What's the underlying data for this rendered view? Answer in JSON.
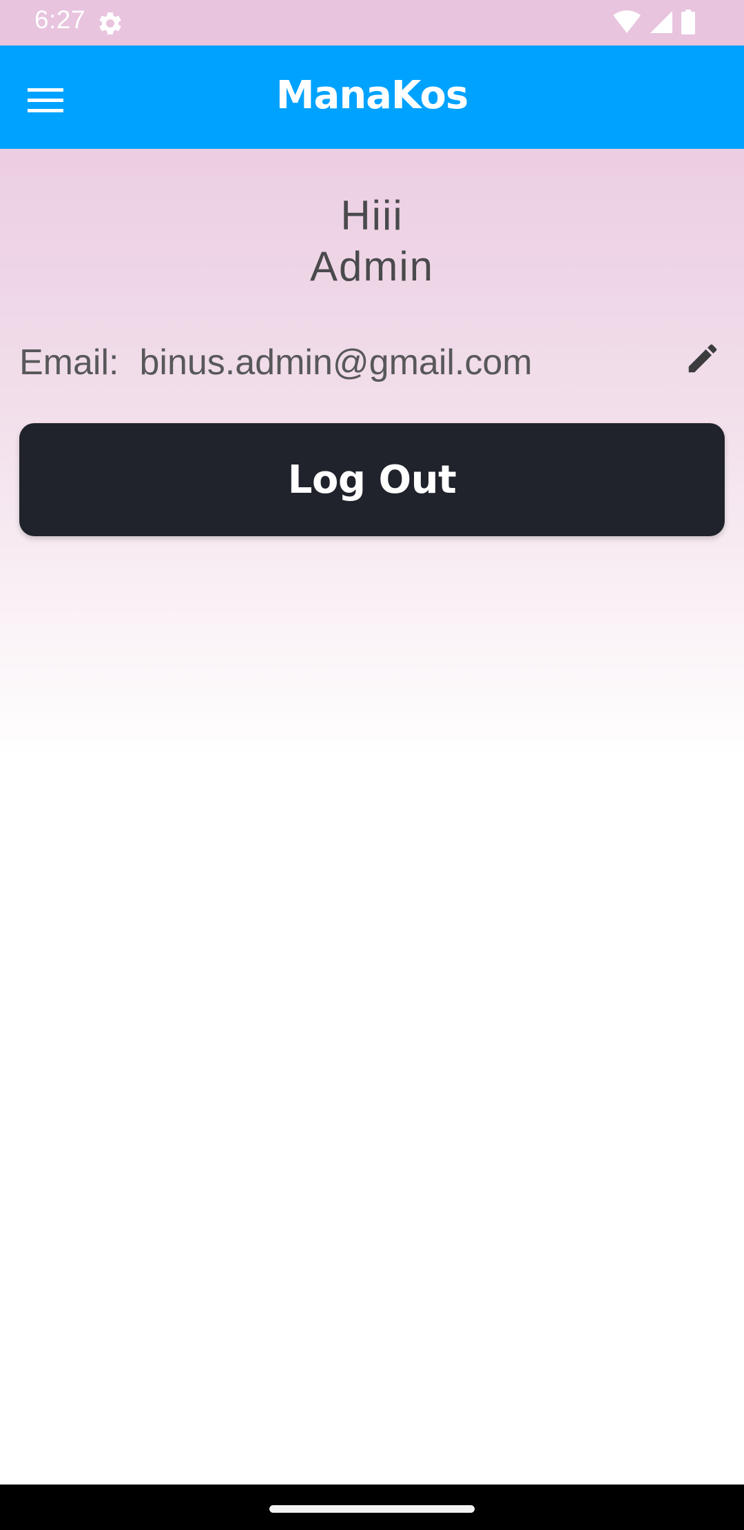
{
  "status_bar": {
    "time": "6:27",
    "icons": [
      "settings-icon",
      "wifi-icon",
      "signal-icon",
      "battery-icon"
    ]
  },
  "app_bar": {
    "title": "ManaKos",
    "menu_icon": "hamburger-menu-icon",
    "background_color": "#00a2ff"
  },
  "profile": {
    "greeting_line1": "Hiii",
    "greeting_line2": "Admin",
    "email_label": "Email:",
    "email_value": "binus.admin@gmail.com",
    "edit_icon": "pencil-icon"
  },
  "actions": {
    "logout_label": "Log Out",
    "logout_color": "#20232b"
  },
  "nav_bar": {
    "handle": "home-gesture-handle"
  }
}
